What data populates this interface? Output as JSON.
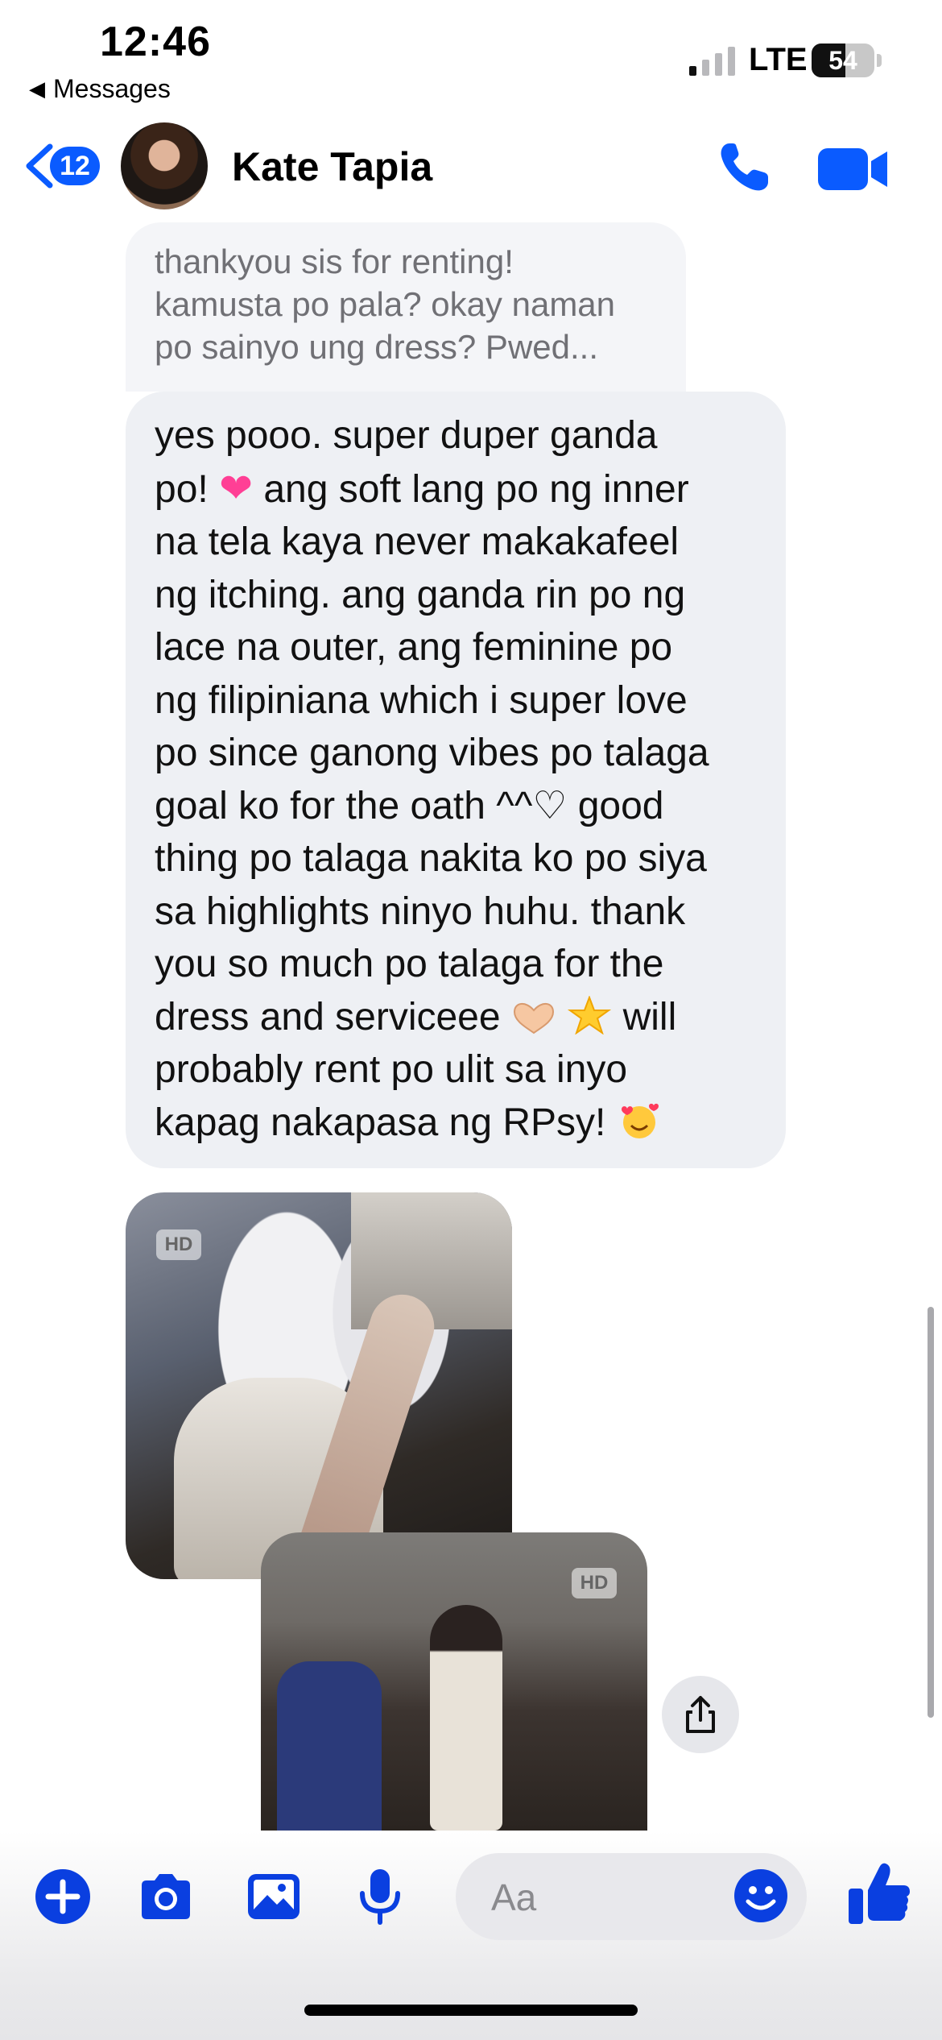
{
  "status_bar": {
    "time": "12:46",
    "back_app": "Messages",
    "network": "LTE",
    "battery": "54",
    "battery_level": 0.54
  },
  "header": {
    "unread_count": "12",
    "contact_name": "Kate Tapia",
    "accent_color": "#0a5bff"
  },
  "conversation": {
    "reply_preview_lines": [
      "thankyou sis for renting!",
      "kamusta po pala? okay naman",
      "po sainyo ung dress?  Pwed..."
    ],
    "message_lines": [
      "yes pooo. super duper ganda",
      "ang soft lang po ng inner",
      "na tela kaya never makakafeel",
      "ng itching. ang ganda rin po ng",
      "lace na outer, ang feminine po",
      "ng filipiniana which i super love",
      "po since ganong vibes po talaga",
      "goal ko for the oath ^^♡ good",
      "thing po talaga nakita ko po siya",
      "sa highlights ninyo huhu. thank",
      "you so much po talaga for the",
      "dress and serviceee",
      "will",
      "probably rent po ulit sa inyo",
      "kapag nakapasa ng RPsy!"
    ],
    "message_line2_prefix": "po!",
    "photo_badge": "HD"
  },
  "composer": {
    "placeholder": "Aa"
  }
}
